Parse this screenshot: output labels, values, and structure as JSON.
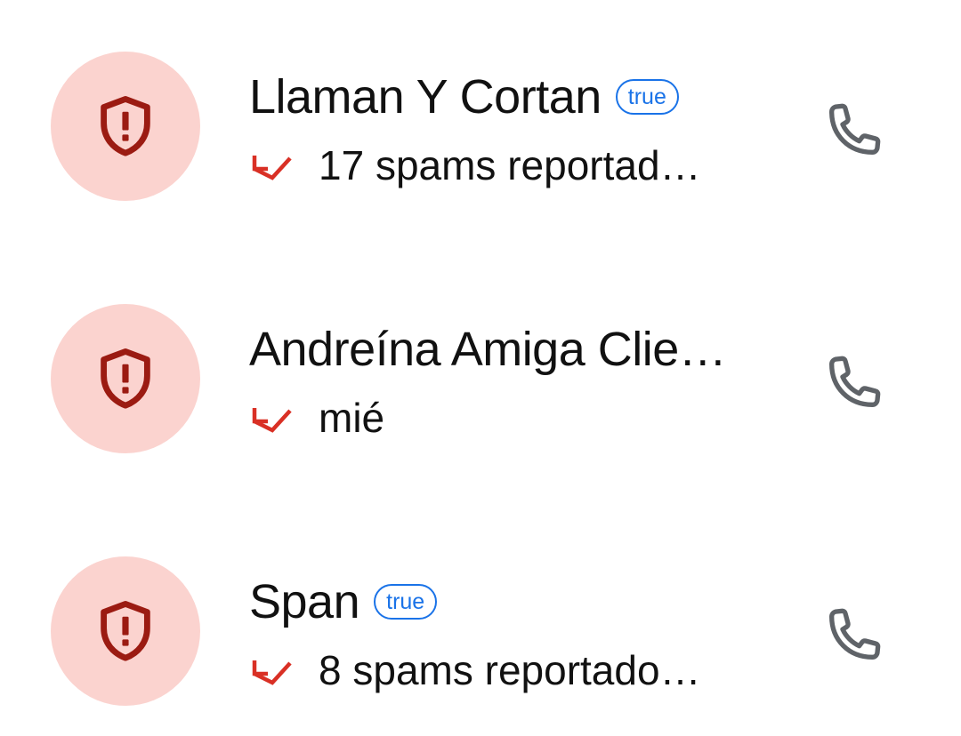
{
  "colors": {
    "avatar_bg": "#fbd3cf",
    "shield_icon": "#9b1b12",
    "missed_call_arrow": "#d93025",
    "badge_accent": "#1a73e8",
    "phone_icon": "#5f6368"
  },
  "calls": [
    {
      "avatar_icon": "shield-alert-icon",
      "name": "Llaman Y Cortan",
      "badge": "true",
      "call_type_icon": "missed-call-icon",
      "detail": "17 spams reportad…",
      "action_icon": "phone-icon"
    },
    {
      "avatar_icon": "shield-alert-icon",
      "name": "Andreína Amiga Clie…",
      "call_type_icon": "missed-call-icon",
      "detail": "mié",
      "action_icon": "phone-icon"
    },
    {
      "avatar_icon": "shield-alert-icon",
      "name": "Span",
      "badge": "true",
      "call_type_icon": "missed-call-icon",
      "detail": "8 spams reportado…",
      "action_icon": "phone-icon"
    }
  ]
}
